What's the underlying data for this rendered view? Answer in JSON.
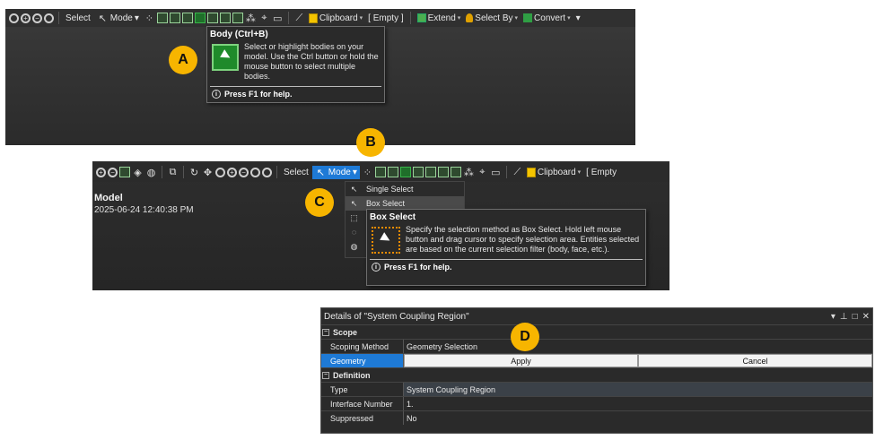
{
  "panel_a": {
    "toolbar": {
      "select_label": "Select",
      "mode_label": "Mode",
      "clipboard_label": "Clipboard",
      "empty_label": "[ Empty ]",
      "extend_label": "Extend",
      "select_by_label": "Select By",
      "convert_label": "Convert"
    },
    "tooltip": {
      "title": "Body (Ctrl+B)",
      "text": "Select or highlight bodies on your model. Use the Ctrl button or hold the mouse button to select multiple bodies.",
      "help": "Press F1 for help."
    },
    "badge": "A"
  },
  "panel_b": {
    "toolbar": {
      "select_label": "Select",
      "mode_label": "Mode",
      "clipboard_label": "Clipboard",
      "empty_label": "[ Empty"
    },
    "model_title": "Model",
    "model_date": "2025-06-24 12:40:38 PM",
    "dropdown": {
      "items": [
        {
          "label": "Single Select"
        },
        {
          "label": "Box Select"
        },
        {
          "label": ""
        },
        {
          "label": ""
        },
        {
          "label": ""
        }
      ]
    },
    "tooltip": {
      "title": "Box Select",
      "text": "Specify the selection method as Box Select. Hold left mouse button and drag cursor to specify selection area. Entities selected are based on the current selection filter (body, face, etc.).",
      "help": "Press F1 for help."
    },
    "badge_b": "B",
    "badge_c": "C"
  },
  "details": {
    "title": "Details of \"System Coupling Region\"",
    "badge": "D",
    "groups": [
      {
        "name": "Scope",
        "rows": [
          {
            "key": "Scoping Method",
            "value": "Geometry Selection"
          }
        ]
      }
    ],
    "geometry_key": "Geometry",
    "apply_label": "Apply",
    "cancel_label": "Cancel",
    "definition": {
      "name": "Definition",
      "rows": [
        {
          "key": "Type",
          "value": "System Coupling Region"
        },
        {
          "key": "Interface Number",
          "value": "1."
        },
        {
          "key": "Suppressed",
          "value": "No"
        }
      ]
    }
  },
  "colors": {
    "accent": "#1e7ad6",
    "badge": "#f7b500",
    "select_green": "#39b54a"
  }
}
